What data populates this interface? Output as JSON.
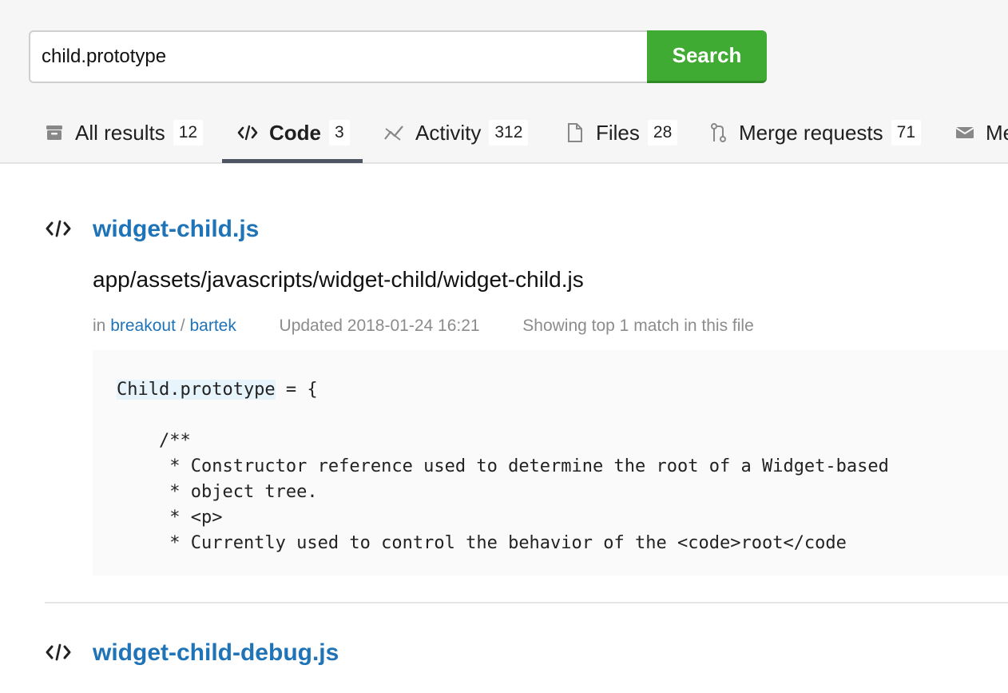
{
  "search": {
    "query": "child.prototype",
    "button_label": "Search"
  },
  "tabs": [
    {
      "label": "All results",
      "count": "12",
      "icon": "archive-icon"
    },
    {
      "label": "Code",
      "count": "3",
      "icon": "code-icon",
      "active": true
    },
    {
      "label": "Activity",
      "count": "312",
      "icon": "activity-icon"
    },
    {
      "label": "Files",
      "count": "28",
      "icon": "file-icon"
    },
    {
      "label": "Merge requests",
      "count": "71",
      "icon": "merge-request-icon"
    },
    {
      "label": "Me",
      "icon": "mail-icon"
    }
  ],
  "results": [
    {
      "title": "widget-child.js",
      "path": "app/assets/javascripts/widget-child/widget-child.js",
      "in_prefix": "in",
      "project": "breakout",
      "separator": "/",
      "owner": "bartek",
      "updated": "Updated 2018-01-24 16:21",
      "match_info": "Showing top 1 match in this file",
      "code": {
        "highlight": "Child.prototype",
        "rest_first": " = {",
        "lines": [
          "    /**",
          "     * Constructor reference used to determine the root of a Widget-based",
          "     * object tree.",
          "     * <p>",
          "     * Currently used to control the behavior of the <code>root</code"
        ]
      }
    },
    {
      "title": "widget-child-debug.js"
    }
  ],
  "colors": {
    "accent_link": "#1f73b7",
    "search_button": "#3fab32",
    "active_tab_underline": "#4d5563"
  }
}
